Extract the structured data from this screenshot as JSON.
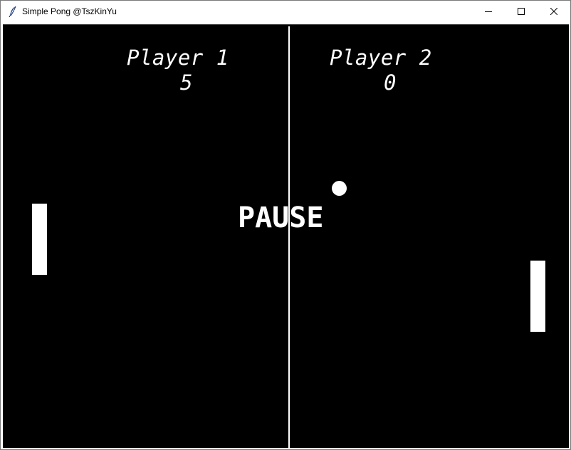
{
  "window": {
    "title": "Simple Pong @TszKinYu",
    "icon": "feather-icon",
    "controls": [
      "minimize-icon",
      "maximize-icon",
      "close-icon"
    ]
  },
  "game": {
    "background_color": "#000000",
    "foreground_color": "#ffffff",
    "player1": {
      "name": "Player 1",
      "score": "5"
    },
    "player2": {
      "name": "Player 2",
      "score": "0"
    },
    "status": "PAUSE"
  }
}
